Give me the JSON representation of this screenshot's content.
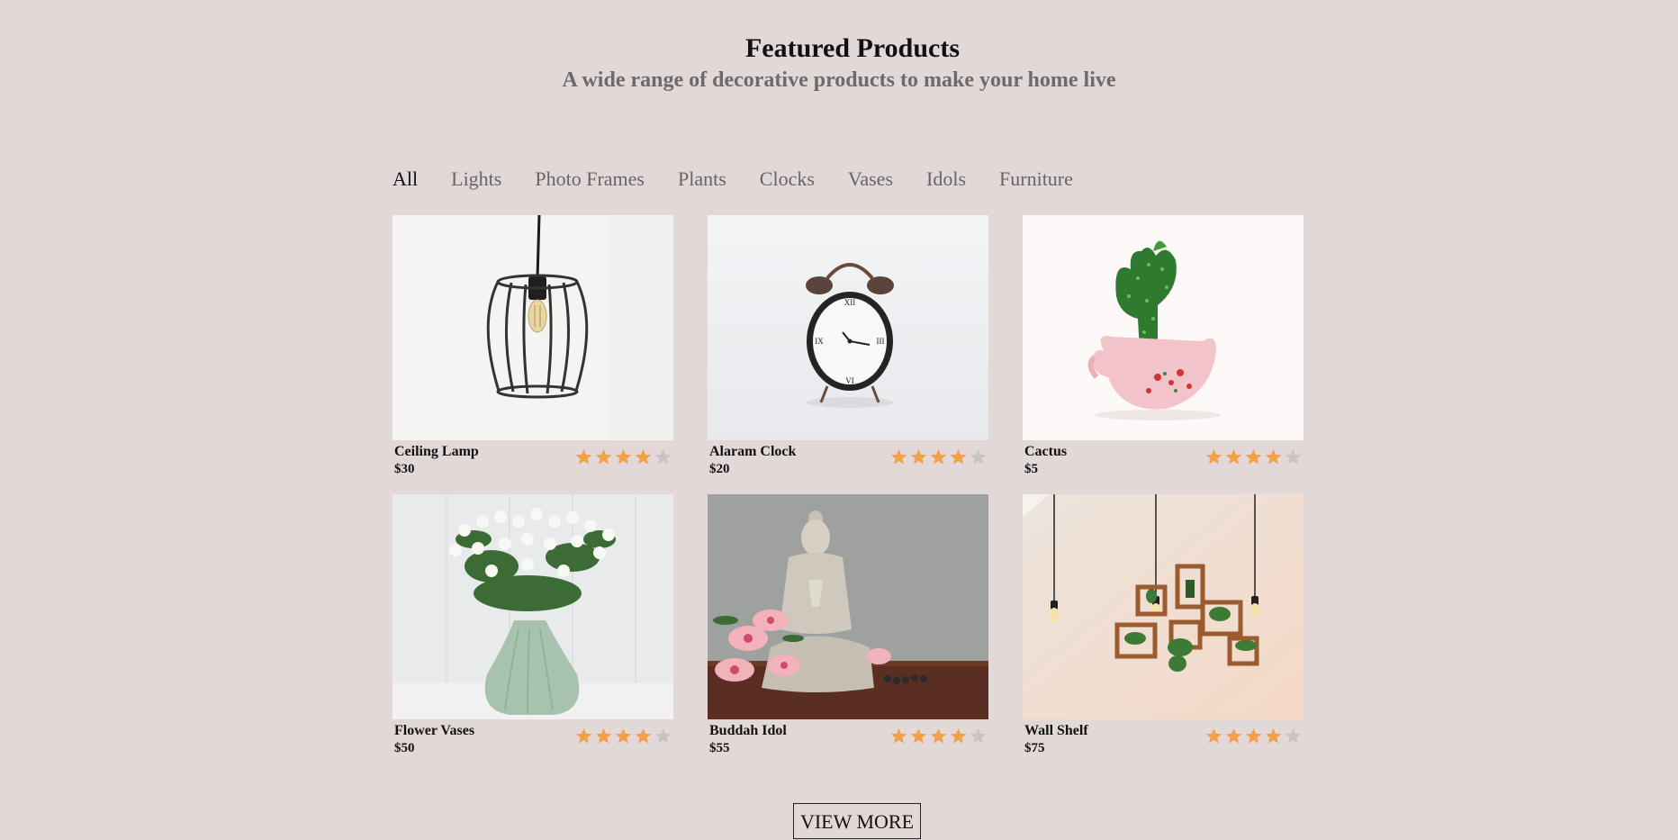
{
  "header": {
    "title": "Featured Products",
    "subtitle": "A wide range of decorative products to make your home live"
  },
  "filters": [
    {
      "label": "All",
      "active": true
    },
    {
      "label": "Lights",
      "active": false
    },
    {
      "label": "Photo Frames",
      "active": false
    },
    {
      "label": "Plants",
      "active": false
    },
    {
      "label": "Clocks",
      "active": false
    },
    {
      "label": "Vases",
      "active": false
    },
    {
      "label": "Idols",
      "active": false
    },
    {
      "label": "Furniture",
      "active": false
    }
  ],
  "products": [
    {
      "name": "Ceiling Lamp",
      "price": "$30",
      "rating": 4,
      "max_rating": 5
    },
    {
      "name": "Alaram Clock",
      "price": "$20",
      "rating": 4,
      "max_rating": 5
    },
    {
      "name": "Cactus",
      "price": "$5",
      "rating": 4,
      "max_rating": 5
    },
    {
      "name": "Flower Vases",
      "price": "$50",
      "rating": 4,
      "max_rating": 5
    },
    {
      "name": "Buddah Idol",
      "price": "$55",
      "rating": 4,
      "max_rating": 5
    },
    {
      "name": "Wall Shelf",
      "price": "$75",
      "rating": 4,
      "max_rating": 5
    }
  ],
  "colors": {
    "background": "#e2d8d8",
    "star_filled": "#f2a04a",
    "star_empty": "#c9c4c4",
    "subtitle": "#6b6b6b"
  },
  "view_more": {
    "label": "VIEW MORE"
  }
}
